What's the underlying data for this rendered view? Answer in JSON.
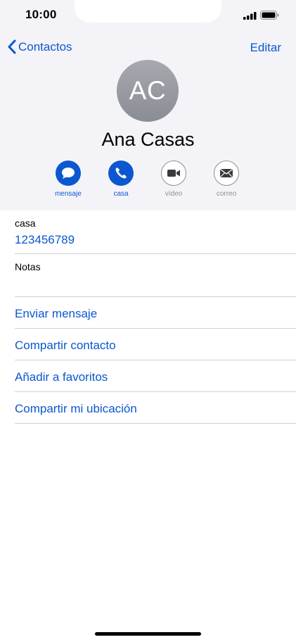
{
  "status": {
    "time": "10:00"
  },
  "nav": {
    "back_label": "Contactos",
    "edit_label": "Editar"
  },
  "contact": {
    "initials": "AC",
    "name": "Ana Casas"
  },
  "actions": [
    {
      "label": "mensaje",
      "icon": "message-icon",
      "enabled": true
    },
    {
      "label": "casa",
      "icon": "phone-icon",
      "enabled": true
    },
    {
      "label": "vídeo",
      "icon": "video-icon",
      "enabled": false
    },
    {
      "label": "correo",
      "icon": "mail-icon",
      "enabled": false
    }
  ],
  "phone": {
    "label": "casa",
    "number": "123456789"
  },
  "notes": {
    "label": "Notas"
  },
  "links": {
    "send_message": "Enviar mensaje",
    "share_contact": "Compartir contacto",
    "add_favorites": "Añadir a favoritos",
    "share_location": "Compartir mi ubicación"
  },
  "colors": {
    "accent": "#0b57d0",
    "header_bg": "#f4f4f8",
    "separator": "#d1d1d6"
  }
}
